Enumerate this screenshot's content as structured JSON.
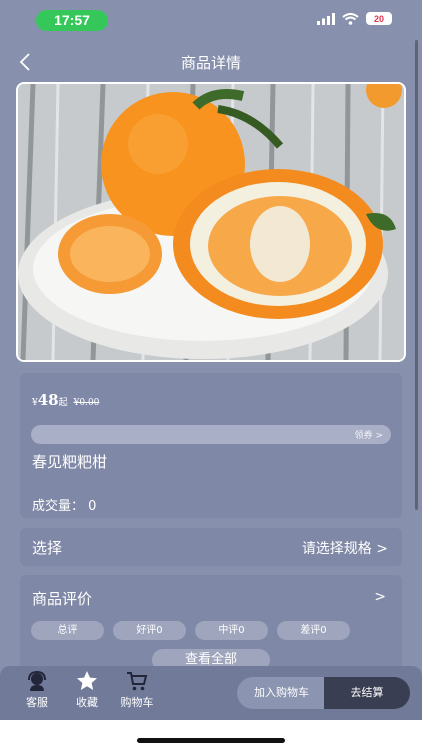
{
  "status_bar": {
    "time": "17:57",
    "battery": "20",
    "icons": [
      "cellular-icon",
      "wifi-icon",
      "battery-icon"
    ]
  },
  "nav": {
    "title": "商品详情",
    "back_icon": "chevron-left-icon"
  },
  "product": {
    "image": "orange-tangerine-photo",
    "price_symbol": "¥",
    "price": "48",
    "price_suffix": "起",
    "original_price": "¥0.00",
    "coupon_label": "领券 >",
    "name": "春见粑粑柑",
    "sales_label": "成交量：",
    "sales_value": "0"
  },
  "spec": {
    "label": "选择",
    "placeholder": "请选择规格 >"
  },
  "reviews": {
    "title": "商品评价",
    "arrow": ">",
    "chips": [
      {
        "label": "总评"
      },
      {
        "label": "好评0"
      },
      {
        "label": "中评0"
      },
      {
        "label": "差评0"
      }
    ],
    "view_all": "查看全部"
  },
  "bottom_bar": {
    "tabs": [
      {
        "label": "客服",
        "icon": "customer-service-icon"
      },
      {
        "label": "收藏",
        "icon": "star-icon"
      },
      {
        "label": "购物车",
        "icon": "shopping-cart-icon"
      }
    ],
    "add_to_cart": "加入购物车",
    "checkout": "去结算"
  },
  "colors": {
    "background": "#8790ad",
    "card": "#7f88a6",
    "checkout": "#3a3e52",
    "time_pill": "#35c759"
  }
}
